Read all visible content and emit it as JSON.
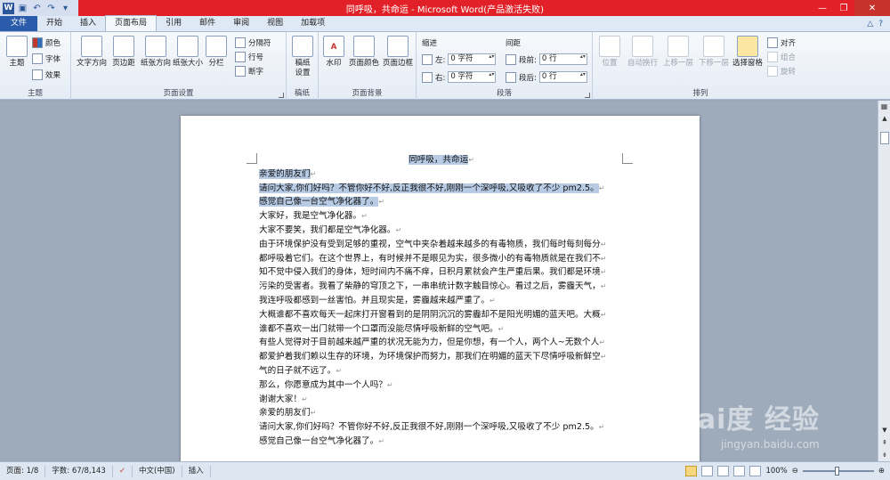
{
  "window": {
    "title": "同呼吸，共命运 - Microsoft Word(产品激活失败)"
  },
  "tabs": [
    "文件",
    "开始",
    "插入",
    "页面布局",
    "引用",
    "邮件",
    "审阅",
    "视图",
    "加载项"
  ],
  "ribbon": {
    "theme_group": {
      "label": "主题",
      "theme": "主题",
      "colors": "颜色",
      "fonts": "字体",
      "effects": "效果"
    },
    "page_setup": {
      "label": "页面设置",
      "text_dir": "文字方向",
      "margins": "页边距",
      "orientation": "纸张方向",
      "size": "纸张大小",
      "columns": "分栏",
      "breaks": "分隔符",
      "line_numbers": "行号",
      "hyphenation": "断字"
    },
    "manuscript": {
      "label": "稿纸",
      "button": "稿纸\n设置"
    },
    "page_bg": {
      "label": "页面背景",
      "watermark": "水印",
      "page_color": "页面颜色",
      "page_border": "页面边框"
    },
    "paragraph": {
      "label": "段落",
      "indent_title": "缩进",
      "left": "左:",
      "right": "右:",
      "left_val": "0 字符",
      "right_val": "0 字符",
      "spacing_title": "间距",
      "before": "段前:",
      "after": "段后:",
      "before_val": "0 行",
      "after_val": "0 行"
    },
    "arrange": {
      "label": "排列",
      "position": "位置",
      "wrap": "自动换行",
      "forward": "上移一层",
      "backward": "下移一层",
      "select_pane": "选择窗格",
      "align": "对齐",
      "group": "组合",
      "rotate": "旋转"
    }
  },
  "document": {
    "lines": [
      {
        "text": "同呼吸，共命运",
        "center": true,
        "hl": true
      },
      {
        "text": "亲爱的朋友们",
        "hl": true
      },
      {
        "text": "请问大家,你们好吗？不管你好不好,反正我很不好,刚刚一个深呼吸,又吸收了不少 pm2.5。",
        "hl": true
      },
      {
        "text": "感觉自己像一台空气净化器了。",
        "hl": true
      },
      {
        "text": "大家好，我是空气净化器。"
      },
      {
        "text": "大家不要笑，我们都是空气净化器。"
      },
      {
        "text": "由于环境保护没有受到足够的重视，空气中夹杂着越来越多的有毒物质，我们每时每刻每分"
      },
      {
        "text": "都呼吸着它们。在这个世界上，有时候并不是眼见为实，很多微小的有毒物质就是在我们不"
      },
      {
        "text": "知不觉中侵入我们的身体，短时间内不痛不痒，日积月累就会产生严重后果。我们都是环境"
      },
      {
        "text": "污染的受害者。我看了柴静的穹顶之下，一串串统计数字触目惊心。看过之后，雾霾天气，"
      },
      {
        "text": "我连呼吸都感到一丝害怕。并且现实是，雾霾越来越严重了。"
      },
      {
        "text": "大概谁都不喜欢每天一起床打开窗看到的是阴阴沉沉的雾霾却不是阳光明媚的蓝天吧。大概"
      },
      {
        "text": "谁都不喜欢一出门就带一个口罩而没能尽情呼吸新鲜的空气吧。"
      },
      {
        "text": "有些人觉得对于目前越来越严重的状况无能为力，但是你想，有一个人，两个人~无数个人"
      },
      {
        "text": "都爱护着我们赖以生存的环境，为环境保护而努力，那我们在明媚的蓝天下尽情呼吸新鲜空"
      },
      {
        "text": "气的日子就不远了。"
      },
      {
        "text": "那么，你愿意成为其中一个人吗？"
      },
      {
        "text": "谢谢大家！"
      },
      {
        "text": "亲爱的朋友们"
      },
      {
        "text": "请问大家,你们好吗？不管你好不好,反正我很不好,刚刚一个深呼吸,又吸收了不少 pm2.5。"
      },
      {
        "text": "感觉自己像一台空气净化器了。"
      }
    ]
  },
  "status": {
    "page": "页面: 1/8",
    "words": "字数: 67/8,143",
    "lang": "中文(中国)",
    "mode": "插入",
    "zoom": "100%"
  },
  "watermark": {
    "main": "Bai度 经验",
    "sub": "jingyan.baidu.com"
  }
}
